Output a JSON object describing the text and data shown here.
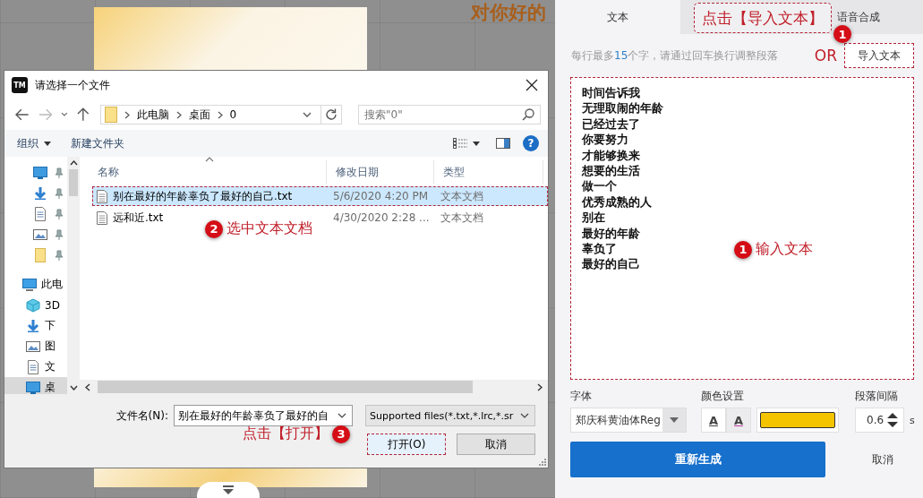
{
  "canvas": {
    "caption": "对你好的"
  },
  "dialog": {
    "app_badge": "TM",
    "title": "请选择一个文件",
    "breadcrumb": [
      {
        "label": "此电脑"
      },
      {
        "label": "桌面"
      },
      {
        "label": "0"
      }
    ],
    "search": {
      "placeholder": "搜索\"0\""
    },
    "toolbar": {
      "organize": "组织",
      "new_folder": "新建文件夹"
    },
    "help_icon": "?",
    "nav_items": [
      {
        "kind": "desktop",
        "selected": false
      },
      {
        "kind": "downloads",
        "selected": false
      },
      {
        "kind": "documents",
        "selected": false
      },
      {
        "kind": "pictures",
        "selected": false
      },
      {
        "kind": "folder",
        "selected": false
      },
      {
        "kind": "pc",
        "label": "此电",
        "selected": false
      },
      {
        "kind": "objects",
        "label": "3D",
        "selected": false
      },
      {
        "kind": "downloads",
        "label": "下",
        "selected": false
      },
      {
        "kind": "pictures",
        "label": "图",
        "selected": false
      },
      {
        "kind": "documents",
        "label": "文",
        "selected": false
      },
      {
        "kind": "desktop",
        "label": "桌",
        "selected": true
      }
    ],
    "columns": [
      "名称",
      "修改日期",
      "类型"
    ],
    "files": [
      {
        "name": "别在最好的年龄辜负了最好的自己.txt",
        "modified": "5/6/2020 4:20 PM",
        "type": "文本文档",
        "selected": true
      },
      {
        "name": "远和近.txt",
        "modified": "4/30/2020 2:28 ...",
        "type": "文本文档",
        "selected": false
      }
    ],
    "select_note": {
      "badge": "2",
      "text": "选中文本文档"
    },
    "filename_label": "文件名(N):",
    "filename": "别在最好的年龄辜负了最好的自",
    "filter": "Supported files(*.txt,*.lrc,*.sr",
    "open_note": {
      "badge": "3",
      "text": "点击【打开】"
    },
    "open_button": "打开(O)",
    "cancel_button": "取消"
  },
  "panel": {
    "tabs": [
      {
        "label": "文本",
        "selected": true
      },
      {
        "label": "语音合成",
        "selected": false
      }
    ],
    "tab_note": "点击【导入文本】",
    "import_badge": "1",
    "or_label": "OR",
    "hint": {
      "before": "每行最多",
      "count": "15",
      "after": "个字，请通过回车换行调整段落"
    },
    "import_button": "导入文本",
    "lines": [
      "时间告诉我",
      "无理取闹的年龄",
      "已经过去了",
      "你要努力",
      "才能够换来",
      "想要的生活",
      "做一个",
      "优秀成熟的人",
      "别在",
      "最好的年龄",
      "辜负了",
      "最好的自己"
    ],
    "input_note": {
      "badge": "1",
      "text": "输入文本"
    },
    "font": {
      "label": "字体",
      "value": "郑庆科黄油体Reg"
    },
    "color": {
      "label": "颜色设置",
      "fill_button": "A",
      "outline_button": "A",
      "swatch": {
        "color": "#f5c400"
      }
    },
    "spacing": {
      "label": "段落间隔",
      "value": "0.6",
      "unit": "s"
    },
    "generate_button": "重新生成",
    "cancel_button": "取消"
  }
}
